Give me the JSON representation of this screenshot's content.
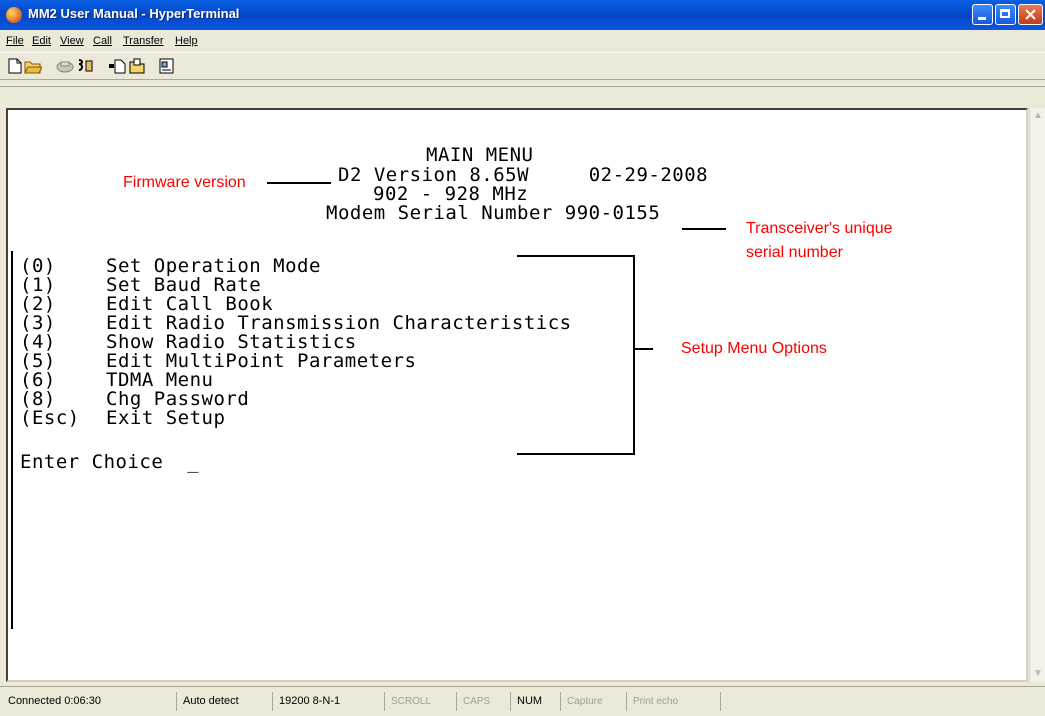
{
  "window": {
    "title": "MM2 User Manual - HyperTerminal"
  },
  "menu": [
    "File",
    "Edit",
    "View",
    "Call",
    "Transfer",
    "Help"
  ],
  "toolbar_icons": [
    "new-connection-icon",
    "open-icon",
    "disconnect-icon",
    "phone-icon",
    "send-icon",
    "receive-icon",
    "properties-icon"
  ],
  "terminal": {
    "title": "MAIN MENU",
    "version_line": "D2 Version 8.65W     02-29-2008",
    "freq_line": "902 - 928 MHz",
    "serial_line": "Modem Serial Number 990-0155",
    "options": [
      {
        "key": "(0)",
        "label": "Set Operation Mode"
      },
      {
        "key": "(1)",
        "label": "Set Baud Rate"
      },
      {
        "key": "(2)",
        "label": "Edit Call Book"
      },
      {
        "key": "(3)",
        "label": "Edit Radio Transmission Characteristics"
      },
      {
        "key": "(4)",
        "label": "Show Radio Statistics"
      },
      {
        "key": "(5)",
        "label": "Edit MultiPoint Parameters"
      },
      {
        "key": "(6)",
        "label": "TDMA Menu"
      },
      {
        "key": "(8)",
        "label": "Chg Password"
      },
      {
        "key": "(Esc)",
        "label": "Exit Setup"
      }
    ],
    "prompt": "Enter Choice  _"
  },
  "annotations": {
    "firmware": "Firmware version",
    "serial1": "Transceiver's unique",
    "serial2": "serial number",
    "setup": "Setup Menu Options"
  },
  "status": {
    "connected": "Connected 0:06:30",
    "detect": "Auto detect",
    "baud": "19200 8-N-1",
    "scroll": "SCROLL",
    "caps": "CAPS",
    "num": "NUM",
    "capture": "Capture",
    "echo": "Print echo"
  }
}
